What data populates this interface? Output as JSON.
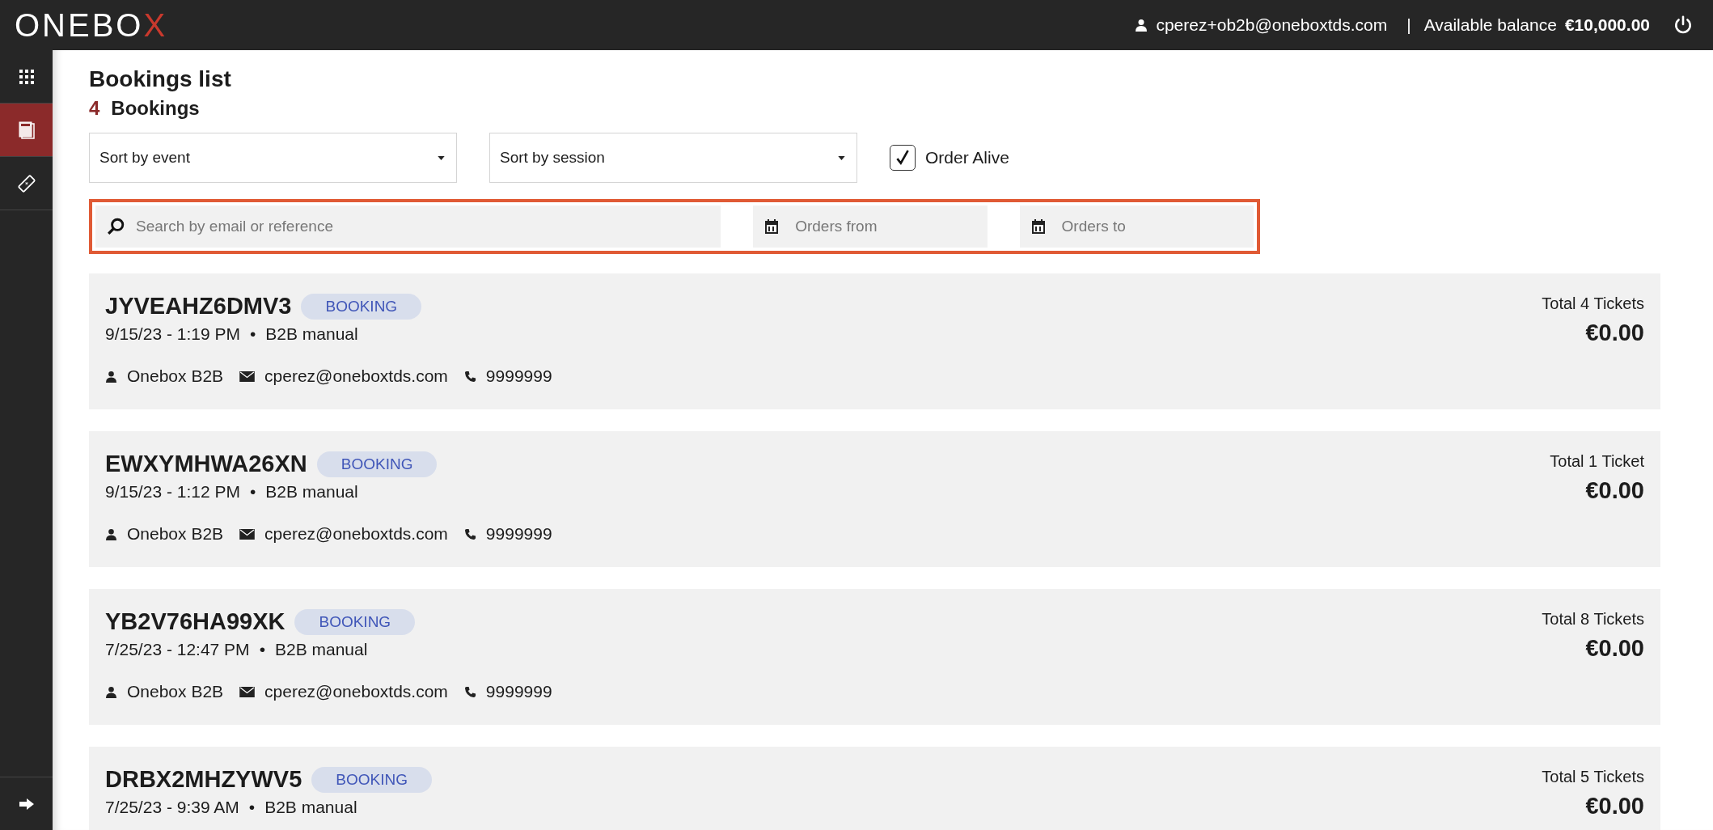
{
  "header": {
    "logo": "ONEBO",
    "logo_accent": "X",
    "user_email": "cperez+ob2b@oneboxtds.com",
    "separator": "|",
    "balance_label": "Available balance",
    "balance_value": "€10,000.00"
  },
  "sidebar": {
    "items": [
      {
        "kind": "grid",
        "selected": false
      },
      {
        "kind": "book",
        "selected": true
      },
      {
        "kind": "ticket",
        "selected": false
      }
    ]
  },
  "page": {
    "title": "Bookings list",
    "count": "4",
    "count_label": "Bookings"
  },
  "filters": {
    "sort_event": {
      "value": "Sort by event"
    },
    "sort_session": {
      "value": "Sort by session"
    },
    "order_alive": {
      "label": "Order Alive",
      "checked": true
    },
    "search": {
      "placeholder": "Search by email or reference"
    },
    "orders_from": {
      "placeholder": "Orders from"
    },
    "orders_to": {
      "placeholder": "Orders to"
    }
  },
  "bookings": [
    {
      "reference": "JYVEAHZ6DMV3",
      "tag": "BOOKING",
      "date": "9/15/23 - 1:19 PM",
      "separator": "•",
      "channel": "B2B manual",
      "name": "Onebox B2B",
      "email": "cperez@oneboxtds.com",
      "phone": "9999999",
      "tickets": "Total 4 Tickets",
      "total": "€0.00"
    },
    {
      "reference": "EWXYMHWA26XN",
      "tag": "BOOKING",
      "date": "9/15/23 - 1:12 PM",
      "separator": "•",
      "channel": "B2B manual",
      "name": "Onebox B2B",
      "email": "cperez@oneboxtds.com",
      "phone": "9999999",
      "tickets": "Total 1 Ticket",
      "total": "€0.00"
    },
    {
      "reference": "YB2V76HA99XK",
      "tag": "BOOKING",
      "date": "7/25/23 - 12:47 PM",
      "separator": "•",
      "channel": "B2B manual",
      "name": "Onebox B2B",
      "email": "cperez@oneboxtds.com",
      "phone": "9999999",
      "tickets": "Total 8 Tickets",
      "total": "€0.00"
    },
    {
      "reference": "DRBX2MHZYWV5",
      "tag": "BOOKING",
      "date": "7/25/23 - 9:39 AM",
      "separator": "•",
      "channel": "B2B manual",
      "tickets": "Total 5 Tickets",
      "total": "€0.00"
    }
  ]
}
